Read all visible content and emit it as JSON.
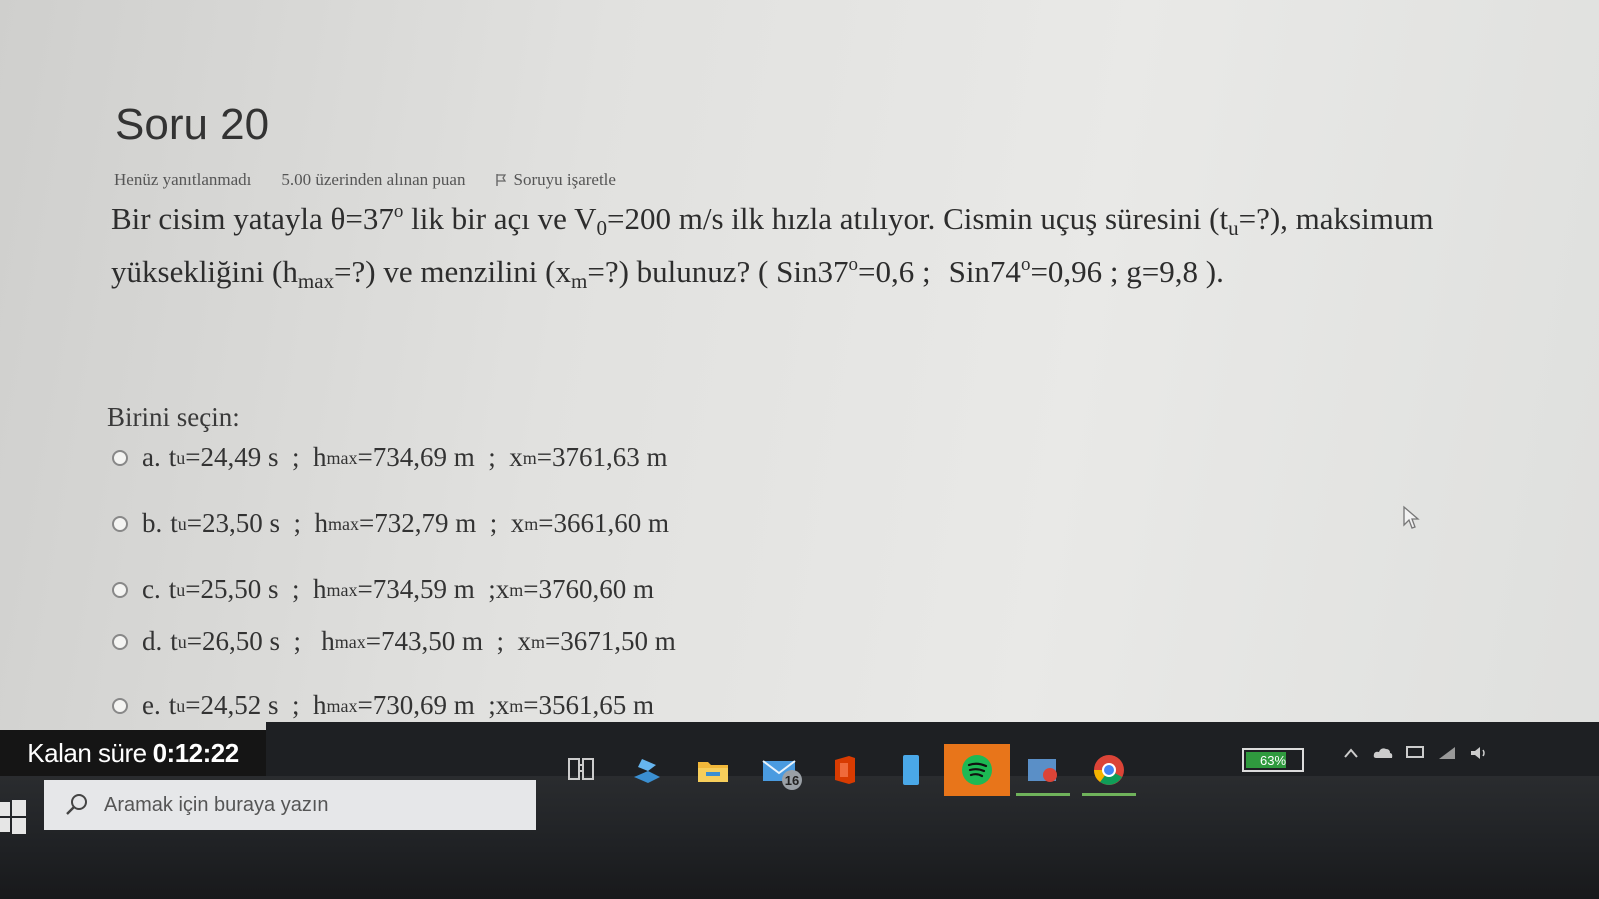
{
  "question": {
    "title": "Soru 20",
    "status": "Henüz yanıtlanmadı",
    "points": "5.00 üzerinden alınan puan",
    "flag_label": "Soruyu işaretle",
    "text": {
      "p1": "Bir cisim yatayla  θ=37",
      "deg1": "o",
      "p2": " lik bir açı ve  V",
      "v_sub": "0",
      "p3": "=200 m/s ilk hızla atılıyor. Cismin uçuş süresini (t",
      "t_sub": "u",
      "p4": "=?), maksimum yüksekliğini (h",
      "h_sub": "max",
      "p5": "=?) ve menzilini (x",
      "x_sub": "m",
      "p6": "=?) bulunuz? ( Sin37",
      "deg2": "o",
      "p7": "=0,6 ;",
      "p8": "Sin74",
      "deg3": "o",
      "p9": "=0,96   ; g=9,8 )."
    }
  },
  "prompt": "Birini seçin:",
  "answers": [
    {
      "letter": "a.",
      "t": "t",
      "t_sub": "u",
      "t_val": "=24,49 s  ;  ",
      "h": "h",
      "h_sub": "max",
      "h_val": "=734,69 m  ;  ",
      "x": "x",
      "x_sub": "m",
      "x_val": "=3761,63 m"
    },
    {
      "letter": "b.",
      "t": "t",
      "t_sub": "u",
      "t_val": "=23,50 s  ;  ",
      "h": "h",
      "h_sub": "max",
      "h_val": "=732,79 m  ;  ",
      "x": "x",
      "x_sub": "m",
      "x_val": "=3661,60 m"
    },
    {
      "letter": "c.",
      "t": "t",
      "t_sub": "u",
      "t_val": "=25,50 s  ;  ",
      "h": "h",
      "h_sub": "max",
      "h_val": "=734,59 m  ;",
      "x": "x",
      "x_sub": "m",
      "x_val": "=3760,60 m"
    },
    {
      "letter": "d.",
      "t": "t",
      "t_sub": "u",
      "t_val": "=26,50 s  ;   ",
      "h": "h",
      "h_sub": "max",
      "h_val": "=743,50 m  ;  ",
      "x": "x",
      "x_sub": "m",
      "x_val": "=3671,50 m"
    },
    {
      "letter": "e.",
      "t": "t",
      "t_sub": "u",
      "t_val": "=24,52 s  ;  ",
      "h": "h",
      "h_sub": "max",
      "h_val": "=730,69 m  ;",
      "x": "x",
      "x_sub": "m",
      "x_val": "=3561,65 m"
    }
  ],
  "timer": {
    "label": "Kalan süre",
    "value": "0:12:22"
  },
  "taskbar": {
    "search_placeholder": "Aramak için buraya yazın",
    "mail_badge": "16",
    "battery": "63%",
    "colors": {
      "spotify": "#1db954",
      "active_bg": "#e8751a",
      "office": "#d83b01",
      "chrome_red": "#db4437"
    },
    "icons": [
      "task-view-icon",
      "people-icon",
      "file-explorer-icon",
      "mail-icon",
      "office-icon",
      "phone-icon",
      "spotify-icon",
      "photos-icon",
      "chrome-icon"
    ]
  }
}
